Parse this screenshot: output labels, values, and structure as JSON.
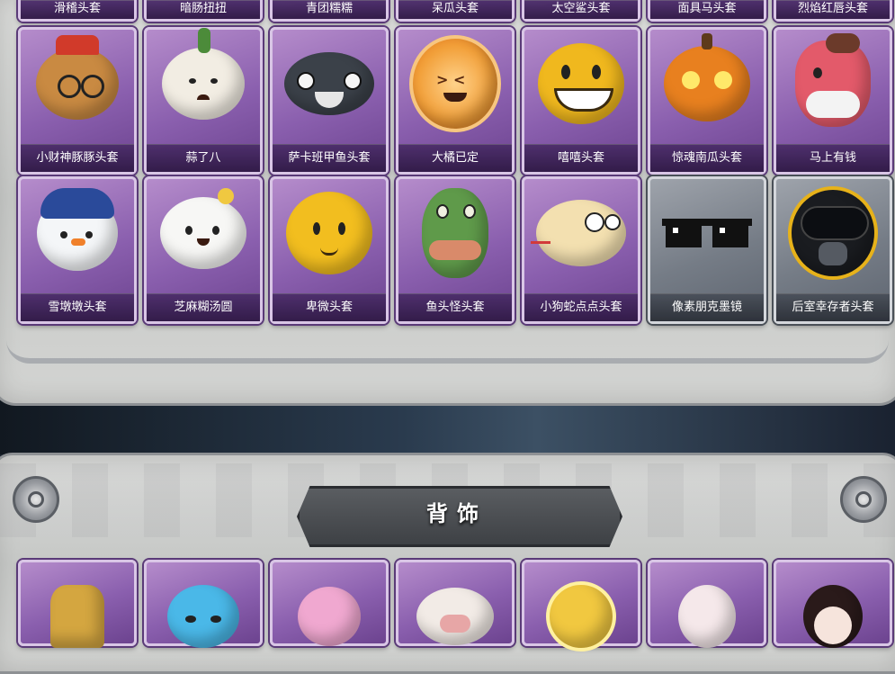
{
  "top_row_partial": [
    "滑稽头套",
    "暗肠扭扭",
    "青团糯糯",
    "呆瓜头套",
    "太空鲨头套",
    "面具马头套",
    "烈焰红唇头套"
  ],
  "row1": [
    {
      "label": "小财神豚豚头套",
      "rarity": "purple",
      "icon": "capybara-god-head-icon",
      "color": "#c98a42"
    },
    {
      "label": "蒜了八",
      "rarity": "purple",
      "icon": "garlic-head-icon",
      "color": "#f2ede3"
    },
    {
      "label": "萨卡班甲鱼头套",
      "rarity": "purple",
      "icon": "fish-head-icon",
      "color": "#3b4149"
    },
    {
      "label": "大橘已定",
      "rarity": "purple",
      "icon": "orange-slice-head-icon",
      "color": "#f2a03a"
    },
    {
      "label": "嘻嘻头套",
      "rarity": "purple",
      "icon": "grin-emoji-head-icon",
      "color": "#f0b81e"
    },
    {
      "label": "惊魂南瓜头套",
      "rarity": "purple",
      "icon": "pumpkin-head-icon",
      "color": "#e8801f"
    },
    {
      "label": "马上有钱",
      "rarity": "purple",
      "icon": "horse-head-icon",
      "color": "#e35a6a"
    }
  ],
  "row2": [
    {
      "label": "雪墩墩头套",
      "rarity": "purple",
      "icon": "snowman-head-icon",
      "color": "#f4f6f8"
    },
    {
      "label": "芝麻糊汤圆",
      "rarity": "purple",
      "icon": "rice-ball-head-icon",
      "color": "#f7f7f5"
    },
    {
      "label": "卑微头套",
      "rarity": "purple",
      "icon": "shy-emoji-head-icon",
      "color": "#f2be1f"
    },
    {
      "label": "鱼头怪头套",
      "rarity": "purple",
      "icon": "fish-man-head-icon",
      "color": "#5f9a4a"
    },
    {
      "label": "小狗蛇点点头套",
      "rarity": "purple",
      "icon": "snake-head-icon",
      "color": "#f3e0b0"
    },
    {
      "label": "像素朋克墨镜",
      "rarity": "grey",
      "icon": "pixel-sunglasses-icon",
      "color": "#111111"
    },
    {
      "label": "后室幸存者头套",
      "rarity": "grey",
      "icon": "gas-mask-helmet-icon",
      "color": "#2a2c30"
    }
  ],
  "section": {
    "title": "背饰"
  },
  "backpieces": [
    {
      "icon": "golden-ornament-icon",
      "color": "#d4a640"
    },
    {
      "icon": "blue-cat-backpiece-icon",
      "color": "#4ab8e8"
    },
    {
      "icon": "unicorn-backpiece-icon",
      "color": "#f0a8d0"
    },
    {
      "icon": "cow-backpiece-icon",
      "color": "#f2ebe6"
    },
    {
      "icon": "sun-crown-backpiece-icon",
      "color": "#f1c840"
    },
    {
      "icon": "fox-backpiece-icon",
      "color": "#f5e8ea"
    },
    {
      "icon": "lady-doll-backpiece-icon",
      "color": "#2a1a1a"
    }
  ]
}
